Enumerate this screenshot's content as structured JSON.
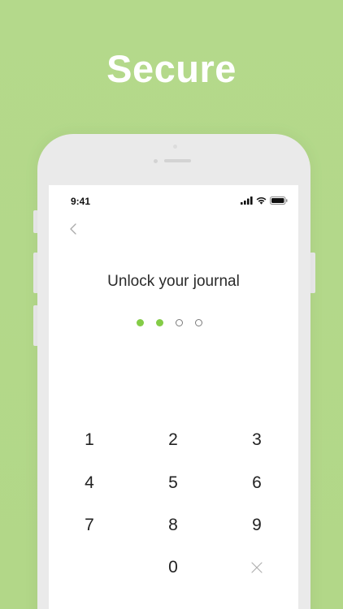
{
  "headline": "Secure",
  "status": {
    "time": "9:41"
  },
  "screen": {
    "title": "Unlock your journal",
    "passcode": {
      "entered": 2,
      "length": 4
    }
  },
  "keypad": {
    "k1": "1",
    "k2": "2",
    "k3": "3",
    "k4": "4",
    "k5": "5",
    "k6": "6",
    "k7": "7",
    "k8": "8",
    "k9": "9",
    "k0": "0"
  },
  "colors": {
    "background": "#b4d98a",
    "accent": "#84cc47",
    "text": "#2a2a2a"
  },
  "icons": {
    "back": "chevron-left-icon",
    "delete": "close-icon",
    "signal": "cellular-signal-icon",
    "wifi": "wifi-icon",
    "battery": "battery-icon"
  }
}
